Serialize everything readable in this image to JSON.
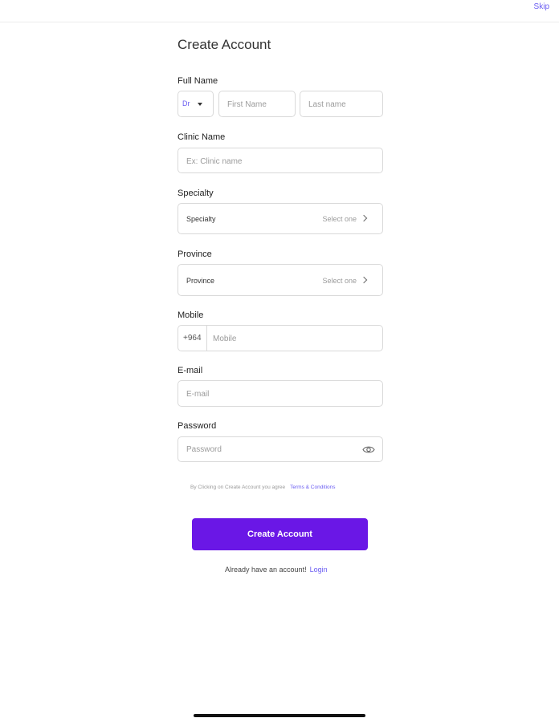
{
  "header": {
    "skip_label": "Skip"
  },
  "form": {
    "title": "Create Account",
    "full_name": {
      "label": "Full Name",
      "title_value": "Dr",
      "first_placeholder": "First Name",
      "last_placeholder": "Last name"
    },
    "clinic": {
      "label": "Clinic Name",
      "placeholder": "Ex: Clinic name"
    },
    "specialty": {
      "label": "Specialty",
      "field_text": "Specialty",
      "select_text": "Select one"
    },
    "province": {
      "label": "Province",
      "field_text": "Province",
      "select_text": "Select one"
    },
    "mobile": {
      "label": "Mobile",
      "prefix": "+964",
      "placeholder": "Mobile"
    },
    "email": {
      "label": "E-mail",
      "placeholder": "E-mail"
    },
    "password": {
      "label": "Password",
      "placeholder": "Password"
    },
    "terms_text": "By Clicking on Create Account you agree",
    "terms_link": "Terms & Conditions",
    "submit_label": "Create Account",
    "login_prompt": "Already have an account!",
    "login_link": "Login"
  },
  "colors": {
    "accent": "#6a17e6",
    "link": "#6a5cf2",
    "border": "#d9d9d9"
  },
  "icons": {
    "eye": "eye-icon",
    "chevron": "chevron-right-icon",
    "caret": "caret-down-icon"
  }
}
